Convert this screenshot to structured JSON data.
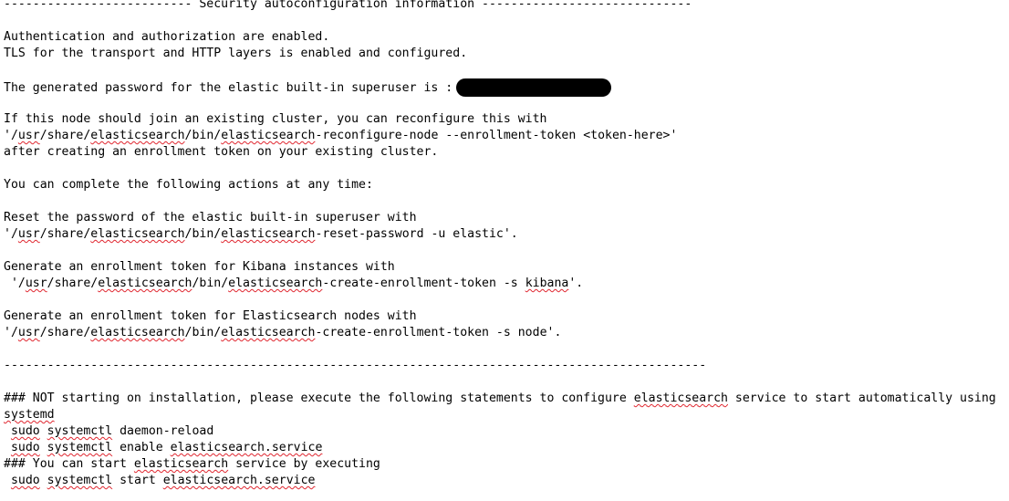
{
  "lines": [
    {
      "segments": [
        {
          "text": "-------------------------- Security autoconfiguration information -----------------------------"
        }
      ]
    },
    {
      "segments": [
        {
          "text": ""
        }
      ]
    },
    {
      "segments": [
        {
          "text": "Authentication and authorization are enabled."
        }
      ]
    },
    {
      "segments": [
        {
          "text": "TLS for the transport and HTTP layers is enabled and configured."
        }
      ]
    },
    {
      "segments": [
        {
          "text": ""
        }
      ]
    },
    {
      "segments": [
        {
          "text": "The generated password for the elastic built-in superuser is :"
        }
      ],
      "redacted": true
    },
    {
      "segments": [
        {
          "text": ""
        }
      ]
    },
    {
      "segments": [
        {
          "text": "If this node should join an existing cluster, you can reconfigure this with"
        }
      ]
    },
    {
      "segments": [
        {
          "text": "'/"
        },
        {
          "text": "usr",
          "sq": true
        },
        {
          "text": "/share/"
        },
        {
          "text": "elasticsearch",
          "sq": true
        },
        {
          "text": "/bin/"
        },
        {
          "text": "elasticsearch",
          "sq": true
        },
        {
          "text": "-reconfigure-node --enrollment-token <token-here>'"
        }
      ]
    },
    {
      "segments": [
        {
          "text": "after creating an enrollment token on your existing cluster."
        }
      ]
    },
    {
      "segments": [
        {
          "text": ""
        }
      ]
    },
    {
      "segments": [
        {
          "text": "You can complete the following actions at any time:"
        }
      ]
    },
    {
      "segments": [
        {
          "text": ""
        }
      ]
    },
    {
      "segments": [
        {
          "text": "Reset the password of the elastic built-in superuser with"
        }
      ]
    },
    {
      "segments": [
        {
          "text": "'/"
        },
        {
          "text": "usr",
          "sq": true
        },
        {
          "text": "/share/"
        },
        {
          "text": "elasticsearch",
          "sq": true
        },
        {
          "text": "/bin/"
        },
        {
          "text": "elasticsearch",
          "sq": true
        },
        {
          "text": "-reset-password -u elastic'."
        }
      ]
    },
    {
      "segments": [
        {
          "text": ""
        }
      ]
    },
    {
      "segments": [
        {
          "text": "Generate an enrollment token for Kibana instances with"
        }
      ]
    },
    {
      "segments": [
        {
          "text": " '/"
        },
        {
          "text": "usr",
          "sq": true
        },
        {
          "text": "/share/"
        },
        {
          "text": "elasticsearch",
          "sq": true
        },
        {
          "text": "/bin/"
        },
        {
          "text": "elasticsearch",
          "sq": true
        },
        {
          "text": "-create-enrollment-token -s "
        },
        {
          "text": "kibana",
          "sq": true
        },
        {
          "text": "'."
        }
      ]
    },
    {
      "segments": [
        {
          "text": ""
        }
      ]
    },
    {
      "segments": [
        {
          "text": "Generate an enrollment token for Elasticsearch nodes with"
        }
      ]
    },
    {
      "segments": [
        {
          "text": "'/"
        },
        {
          "text": "usr",
          "sq": true
        },
        {
          "text": "/share/"
        },
        {
          "text": "elasticsearch",
          "sq": true
        },
        {
          "text": "/bin/"
        },
        {
          "text": "elasticsearch",
          "sq": true
        },
        {
          "text": "-create-enrollment-token -s node'."
        }
      ]
    },
    {
      "segments": [
        {
          "text": ""
        }
      ]
    },
    {
      "segments": [
        {
          "text": "-------------------------------------------------------------------------------------------------"
        }
      ]
    },
    {
      "segments": [
        {
          "text": ""
        }
      ]
    },
    {
      "segments": [
        {
          "text": "### NOT starting on installation, please execute the following statements to configure "
        },
        {
          "text": "elasticsearch",
          "sq": true
        },
        {
          "text": " service to start automatically using"
        }
      ]
    },
    {
      "segments": [
        {
          "text": "systemd",
          "sq": true
        }
      ]
    },
    {
      "segments": [
        {
          "text": " "
        },
        {
          "text": "sudo",
          "sq": true
        },
        {
          "text": " "
        },
        {
          "text": "systemctl",
          "sq": true
        },
        {
          "text": " daemon-reload"
        }
      ]
    },
    {
      "segments": [
        {
          "text": " "
        },
        {
          "text": "sudo",
          "sq": true
        },
        {
          "text": " "
        },
        {
          "text": "systemctl",
          "sq": true
        },
        {
          "text": " enable "
        },
        {
          "text": "elasticsearch.service",
          "sq": true
        }
      ]
    },
    {
      "segments": [
        {
          "text": "### You can start "
        },
        {
          "text": "elasticsearch",
          "sq": true
        },
        {
          "text": " service by executing"
        }
      ]
    },
    {
      "segments": [
        {
          "text": " "
        },
        {
          "text": "sudo",
          "sq": true
        },
        {
          "text": " "
        },
        {
          "text": "systemctl",
          "sq": true
        },
        {
          "text": " start "
        },
        {
          "text": "elasticsearch.service",
          "sq": true
        }
      ]
    }
  ]
}
